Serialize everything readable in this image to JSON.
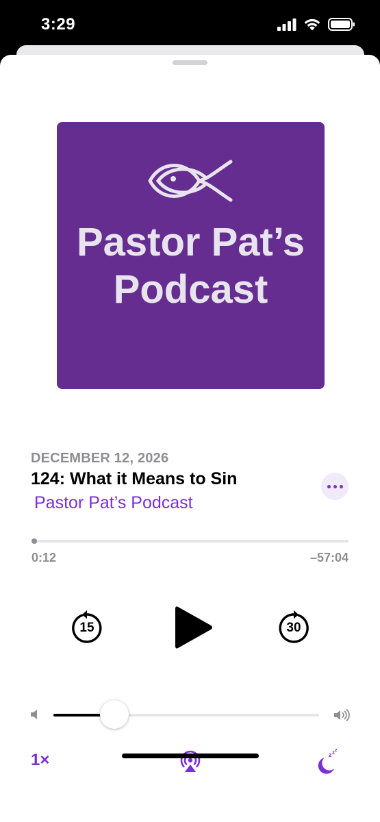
{
  "status_bar": {
    "time": "3:29",
    "icons": [
      "cellular-signal-icon",
      "wifi-icon",
      "battery-icon"
    ]
  },
  "artwork": {
    "title_line1": "Pastor Pat’s",
    "title_line2": "Podcast",
    "background": "#652d90",
    "icon": "ichthys-fish-icon"
  },
  "episode": {
    "date": "DECEMBER 12, 2026",
    "title": "124: What it Means to Sin",
    "show": "Pastor Pat’s Podcast"
  },
  "playback": {
    "elapsed": "0:12",
    "remaining": "–57:04",
    "progress_fraction": 0.0035,
    "skip_back_seconds": "15",
    "skip_forward_seconds": "30",
    "state": "paused"
  },
  "volume": {
    "level_fraction": 0.23
  },
  "footer": {
    "speed_label": "1×",
    "airplay_icon": "airplay-audio-icon",
    "sleep_icon": "sleep-timer-moon-icon"
  },
  "colors": {
    "accent": "#7b2fd6",
    "secondary_text": "#8e8e93"
  }
}
